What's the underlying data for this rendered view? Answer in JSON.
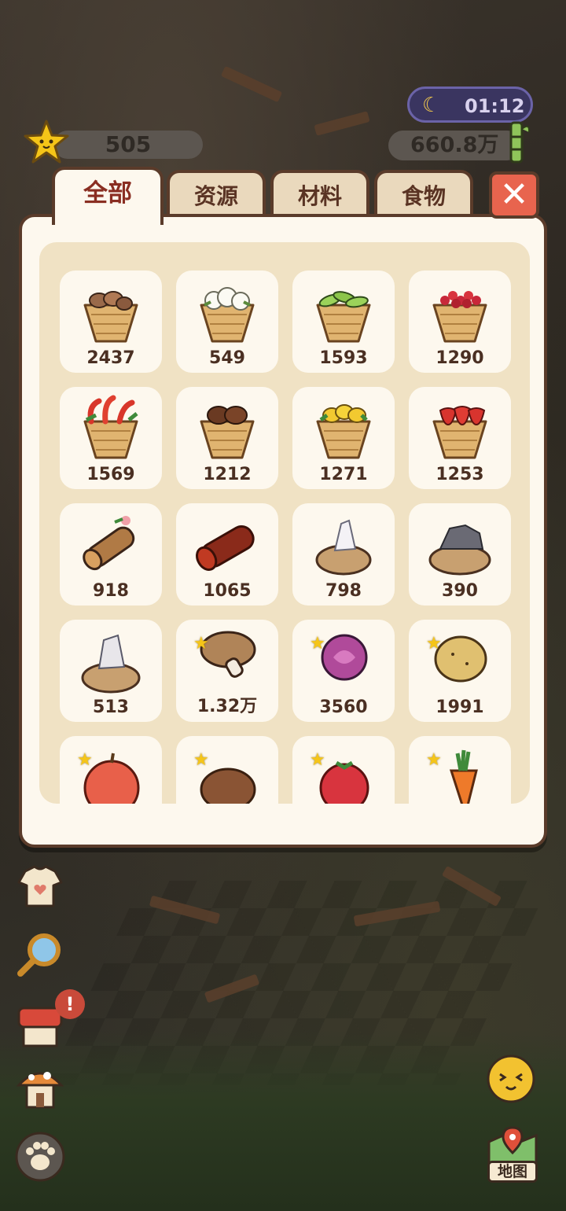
{
  "hud": {
    "stars": "505",
    "time": "01:12",
    "money": "660.8万"
  },
  "tabs": [
    {
      "label": "全部",
      "active": true
    },
    {
      "label": "资源",
      "active": false
    },
    {
      "label": "材料",
      "active": false
    },
    {
      "label": "食物",
      "active": false
    }
  ],
  "close_label": "✕",
  "alert_badge": "!",
  "map_label": "地图",
  "items": [
    {
      "icon": "chestnut-basket-icon",
      "count": "2437"
    },
    {
      "icon": "cotton-basket-icon",
      "count": "549"
    },
    {
      "icon": "soybean-basket-icon",
      "count": "1593"
    },
    {
      "icon": "berry-basket-icon",
      "count": "1290"
    },
    {
      "icon": "chili-basket-icon",
      "count": "1569"
    },
    {
      "icon": "nut-basket-icon",
      "count": "1212"
    },
    {
      "icon": "lemon-basket-icon",
      "count": "1271"
    },
    {
      "icon": "strawberry-basket-icon",
      "count": "1253"
    },
    {
      "icon": "blossom-log-icon",
      "count": "918"
    },
    {
      "icon": "red-log-icon",
      "count": "1065"
    },
    {
      "icon": "crystal-ore-icon",
      "count": "798"
    },
    {
      "icon": "stone-ore-icon",
      "count": "390"
    },
    {
      "icon": "silver-ore-icon",
      "count": "513"
    },
    {
      "icon": "mushroom-icon",
      "count": "1.32万",
      "starred": true
    },
    {
      "icon": "rose-icon",
      "count": "3560",
      "starred": true
    },
    {
      "icon": "potato-icon",
      "count": "1991",
      "starred": true
    },
    {
      "icon": "apple-icon",
      "count": "",
      "starred": true
    },
    {
      "icon": "sweet-potato-icon",
      "count": "",
      "starred": true
    },
    {
      "icon": "raspberry-icon",
      "count": "",
      "starred": true
    },
    {
      "icon": "carrot-icon",
      "count": "",
      "starred": true
    }
  ]
}
